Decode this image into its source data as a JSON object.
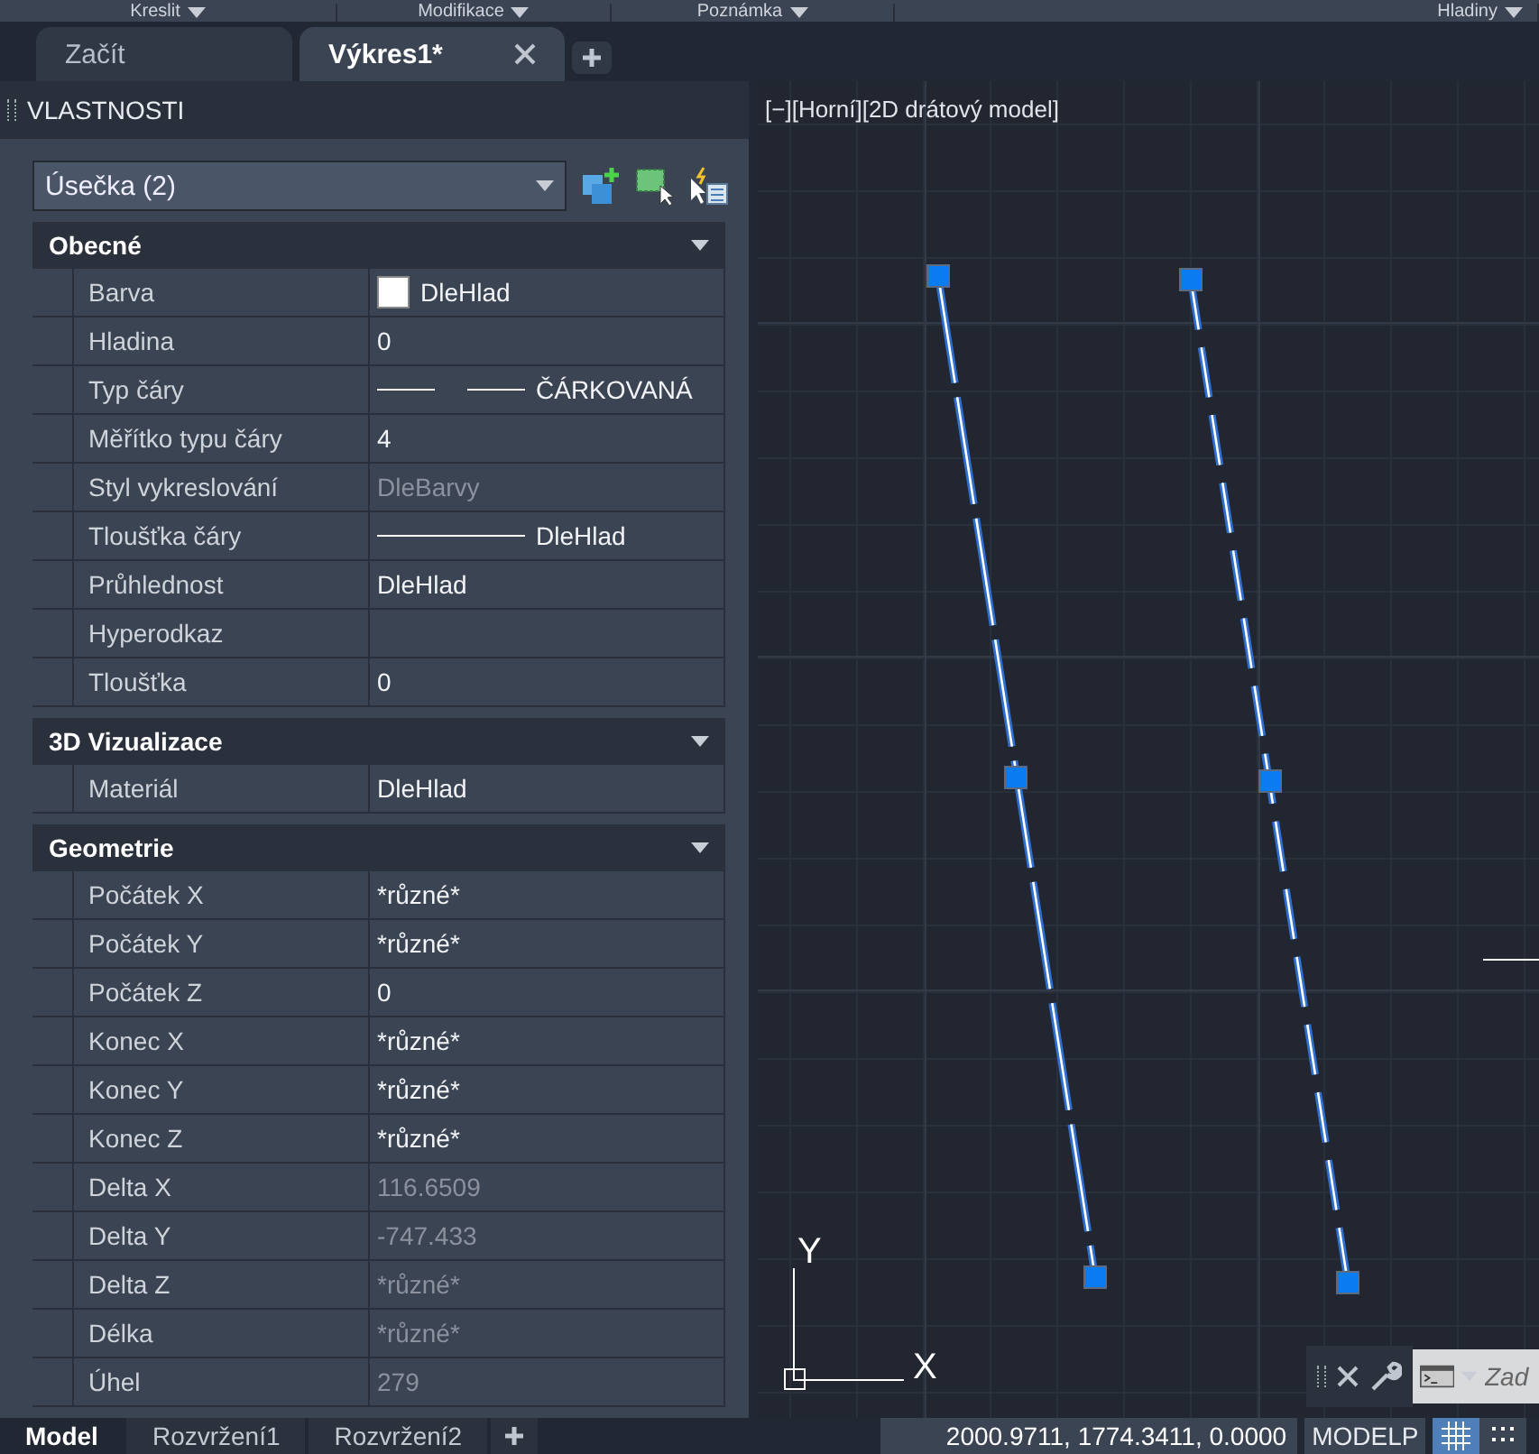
{
  "ribbon_panels": [
    "Kreslit",
    "Modifikace",
    "Poznámka",
    "Hladiny"
  ],
  "file_tabs": [
    {
      "label": "Začít",
      "selected": false,
      "closable": false
    },
    {
      "label": "Výkres1*",
      "selected": true,
      "closable": true
    }
  ],
  "properties_palette": {
    "title": "VLASTNOSTI",
    "selection": "Úsečka (2)",
    "sections": [
      {
        "title": "Obecné",
        "expanded": true,
        "rows": [
          {
            "label": "Barva",
            "value": "DleHlad",
            "kind": "color",
            "disabled": false
          },
          {
            "label": "Hladina",
            "value": "0",
            "kind": "text",
            "disabled": false
          },
          {
            "label": "Typ čáry",
            "value": "ČÁRKOVANÁ",
            "kind": "linetype",
            "disabled": false
          },
          {
            "label": "Měřítko typu čáry",
            "value": "4",
            "kind": "text",
            "disabled": false
          },
          {
            "label": "Styl vykreslování",
            "value": "DleBarvy",
            "kind": "text",
            "disabled": true
          },
          {
            "label": "Tloušťka čáry",
            "value": "DleHlad",
            "kind": "lineweight",
            "disabled": false
          },
          {
            "label": "Průhlednost",
            "value": "DleHlad",
            "kind": "text",
            "disabled": false
          },
          {
            "label": "Hyperodkaz",
            "kind": "text",
            "disabled": false
          },
          {
            "label": "Tloušťka",
            "value": "0",
            "kind": "text",
            "disabled": false
          }
        ]
      },
      {
        "title": "3D Vizualizace",
        "expanded": true,
        "rows": [
          {
            "label": "Materiál",
            "value": "DleHlad",
            "kind": "text",
            "disabled": false
          }
        ]
      },
      {
        "title": "Geometrie",
        "expanded": true,
        "rows": [
          {
            "label": "Počátek X",
            "value": "*různé*",
            "kind": "text",
            "disabled": false
          },
          {
            "label": "Počátek Y",
            "value": "*různé*",
            "kind": "text",
            "disabled": false
          },
          {
            "label": "Počátek Z",
            "value": "0",
            "kind": "text",
            "disabled": false
          },
          {
            "label": "Konec X",
            "value": "*různé*",
            "kind": "text",
            "disabled": false
          },
          {
            "label": "Konec Y",
            "value": "*různé*",
            "kind": "text",
            "disabled": false
          },
          {
            "label": "Konec Z",
            "value": "*různé*",
            "kind": "text",
            "disabled": false
          },
          {
            "label": "Delta X",
            "value": "116.6509",
            "kind": "text",
            "disabled": true
          },
          {
            "label": "Delta Y",
            "value": "-747.433",
            "kind": "text",
            "disabled": true
          },
          {
            "label": "Delta Z",
            "value": "*různé*",
            "kind": "text",
            "disabled": true
          },
          {
            "label": "Délka",
            "value": "*různé*",
            "kind": "text",
            "disabled": true
          },
          {
            "label": "Úhel",
            "value": "279",
            "kind": "text",
            "disabled": true
          }
        ]
      }
    ]
  },
  "viewport": {
    "controls": [
      "[−]",
      "[Horní]",
      "[2D drátový model]"
    ],
    "ucs_x": "X",
    "ucs_y": "Y"
  },
  "command_line": {
    "placeholder": "Zad"
  },
  "layout_tabs": [
    {
      "label": "Model",
      "selected": true
    },
    {
      "label": "Rozvržení1",
      "selected": false
    },
    {
      "label": "Rozvržení2",
      "selected": false
    }
  ],
  "status_bar": {
    "coordinates": "2000.9711, 1774.3411, 0.0000",
    "space": "MODELP",
    "grid_on": true
  }
}
